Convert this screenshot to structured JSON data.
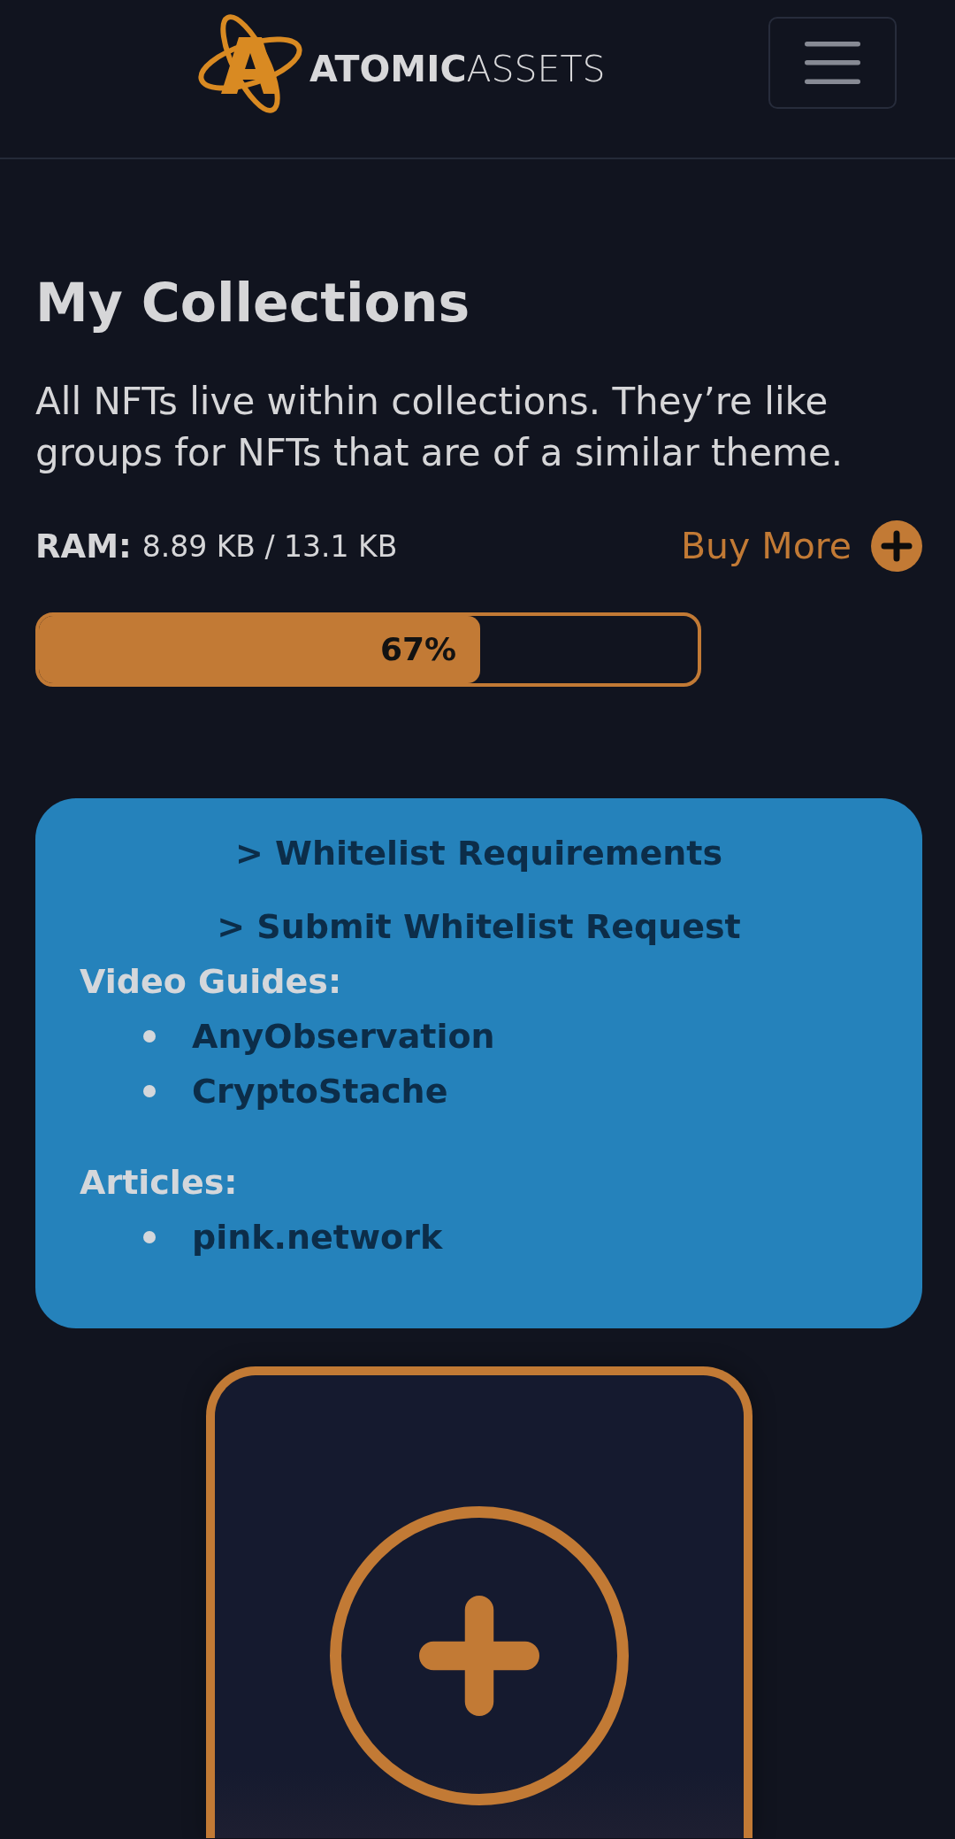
{
  "header": {
    "logo_text": "**ATOMIC**ASSETS"
  },
  "page": {
    "title": "My Collections",
    "description": "All NFTs live within collections. They’re like groups for NFTs that are of a similar theme."
  },
  "ram": {
    "label": "RAM:",
    "usage": "8.89 KB / 13.1 KB",
    "buy_more": "Buy More",
    "level": 0.67,
    "percent": "67%"
  },
  "info_box": {
    "links": [
      "> Whitelist Requirements",
      "> Submit Whitelist Request"
    ],
    "sections": [
      {
        "heading": "Video Guides:",
        "items": [
          "AnyObservation",
          "CryptoStache"
        ]
      },
      {
        "heading": "Articles:",
        "items": [
          "pink.network"
        ]
      }
    ]
  }
}
